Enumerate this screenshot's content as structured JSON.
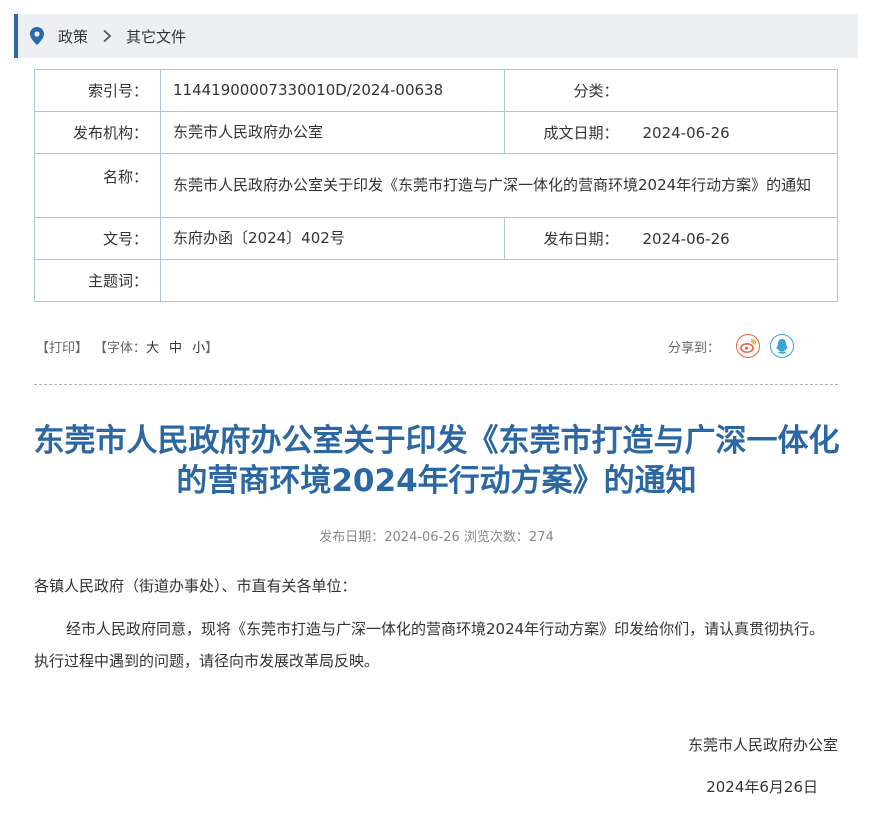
{
  "breadcrumb": {
    "items": [
      "政策",
      "其它文件"
    ]
  },
  "meta": {
    "index_label": "索引号：",
    "index_value": "11441900007330010D/2024-00638",
    "category_label": "分类：",
    "category_value": "",
    "issuer_label": "发布机构：",
    "issuer_value": "东莞市人民政府办公室",
    "created_label": "成文日期：",
    "created_value": "2024-06-26",
    "name_label": "名称：",
    "name_value": "东莞市人民政府办公室关于印发《东莞市打造与广深一体化的营商环境2024年行动方案》的通知",
    "docno_label": "文号：",
    "docno_value": "东府办函〔2024〕402号",
    "published_label": "发布日期：",
    "published_value": "2024-06-26",
    "subject_label": "主题词：",
    "subject_value": ""
  },
  "tools": {
    "print": "【打印】",
    "font_prefix": "【字体：",
    "font_large": "大",
    "font_medium": "中",
    "font_small": "小",
    "font_suffix": "】",
    "share_label": "分享到："
  },
  "article": {
    "title": "东莞市人民政府办公室关于印发《东莞市打造与广深一体化的营商环境2024年行动方案》的通知",
    "publish_info": "发布日期：2024-06-26  浏览次数：274",
    "addressee": "各镇人民政府（街道办事处）、市直有关各单位：",
    "body": "经市人民政府同意，现将《东莞市打造与广深一体化的营商环境2024年行动方案》印发给你们，请认真贯彻执行。执行过程中遇到的问题，请径向市发展改革局反映。",
    "sign_org": "东莞市人民政府办公室",
    "sign_date": "2024年6月26日"
  },
  "colors": {
    "accent": "#2b67a3",
    "table_border": "#a9c7e2",
    "weibo": "#e95f3e",
    "qq": "#3aa6d6"
  },
  "icons": [
    "location-pin-icon",
    "chevron-right-icon",
    "weibo-icon",
    "qq-icon"
  ]
}
